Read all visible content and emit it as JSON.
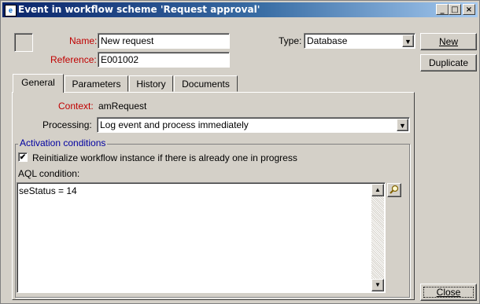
{
  "window": {
    "title": "Event in workflow scheme 'Request approval'",
    "controls": {
      "minimize": "_",
      "maximize": "□",
      "close": "×"
    }
  },
  "form": {
    "name_label": "Name:",
    "name_value": "New request",
    "reference_label": "Reference:",
    "reference_value": "E001002",
    "type_label": "Type:",
    "type_value": "Database"
  },
  "side_buttons": {
    "new": "New",
    "duplicate": "Duplicate",
    "close": "Close"
  },
  "tabs": [
    {
      "label": "General",
      "active": true
    },
    {
      "label": "Parameters",
      "active": false
    },
    {
      "label": "History",
      "active": false
    },
    {
      "label": "Documents",
      "active": false
    }
  ],
  "general": {
    "context_label": "Context:",
    "context_value": "amRequest",
    "processing_label": "Processing:",
    "processing_value": "Log event and process immediately"
  },
  "activation": {
    "group_title": "Activation conditions",
    "reinitialize_label": "Reinitialize workflow instance if there is already one in progress",
    "reinitialize_checked": true,
    "check_glyph": "✔",
    "aql_label": "AQL condition:",
    "aql_value": "seStatus = 14"
  },
  "icons": {
    "dropdown": "dropdown-arrow-icon",
    "scroll_up": "scroll-up-icon",
    "scroll_down": "scroll-down-icon",
    "zoom": "magnifier-icon"
  },
  "colors": {
    "title_gradient_start": "#0a246a",
    "title_gradient_end": "#a6caf0",
    "mandatory_label": "#c00000",
    "group_title": "#0000a0",
    "face": "#d4d0c8"
  }
}
